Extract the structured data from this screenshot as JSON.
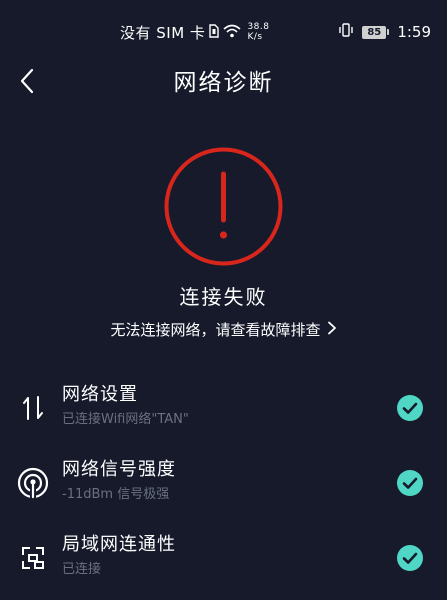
{
  "status_bar": {
    "carrier": "没有 SIM 卡",
    "speed_value": "38.8",
    "speed_unit": "K/s",
    "battery": "85",
    "time": "1:59"
  },
  "header": {
    "back_icon": "chevron-left-icon",
    "title": "网络诊断"
  },
  "result": {
    "icon": "exclamation-circle-icon",
    "title": "连接失败",
    "link_text": "无法连接网络，请查看故障排查",
    "link_icon": "chevron-right-icon"
  },
  "rows": [
    {
      "icon": "network-settings-icon",
      "title": "网络设置",
      "subtitle": "已连接Wifi网络\"TAN\"",
      "status": "ok"
    },
    {
      "icon": "signal-strength-icon",
      "title": "网络信号强度",
      "subtitle": "-11dBm 信号极强",
      "status": "ok"
    },
    {
      "icon": "lan-connectivity-icon",
      "title": "局域网连通性",
      "subtitle": "已连接",
      "status": "ok"
    }
  ],
  "colors": {
    "background": "#161a2b",
    "error": "#d9261c",
    "check": "#4fd6c4",
    "subtitle": "#6b7080"
  }
}
